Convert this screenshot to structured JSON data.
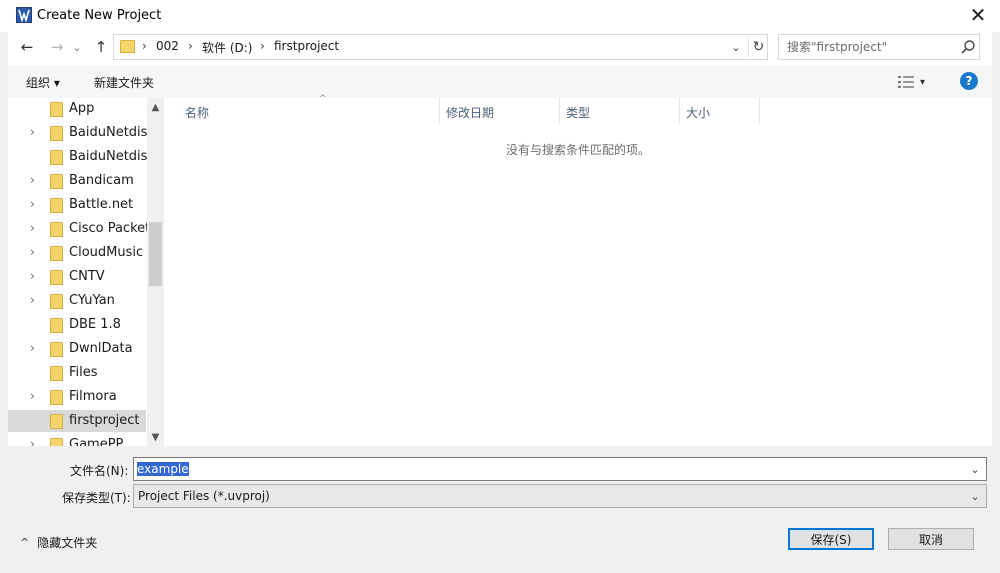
{
  "window": {
    "title": "Create New Project",
    "close_glyph": "✕"
  },
  "nav": {
    "back_glyph": "←",
    "forward_glyph": "→",
    "recent_glyph": "⌄",
    "up_glyph": "↑",
    "breadcrumb": [
      "002",
      "软件 (D:)",
      "firstproject"
    ],
    "separator": "›",
    "dropdown_glyph": "⌄",
    "refresh_glyph": "↻"
  },
  "search": {
    "placeholder": "搜索\"firstproject\""
  },
  "toolbar": {
    "organize_label": "组织 ▾",
    "new_folder_label": "新建文件夹",
    "view_arrow": "▾",
    "help_glyph": "?"
  },
  "tree": {
    "items": [
      {
        "label": "App",
        "expandable": false,
        "selected": false
      },
      {
        "label": "BaiduNetdisk",
        "expandable": true,
        "selected": false
      },
      {
        "label": "BaiduNetdisk",
        "expandable": false,
        "selected": false
      },
      {
        "label": "Bandicam",
        "expandable": true,
        "selected": false
      },
      {
        "label": "Battle.net",
        "expandable": true,
        "selected": false
      },
      {
        "label": "Cisco Packet",
        "expandable": true,
        "selected": false
      },
      {
        "label": "CloudMusic",
        "expandable": true,
        "selected": false
      },
      {
        "label": "CNTV",
        "expandable": true,
        "selected": false
      },
      {
        "label": "CYuYan",
        "expandable": true,
        "selected": false
      },
      {
        "label": "DBE 1.8",
        "expandable": false,
        "selected": false
      },
      {
        "label": "DwnlData",
        "expandable": true,
        "selected": false
      },
      {
        "label": "Files",
        "expandable": false,
        "selected": false
      },
      {
        "label": "Filmora",
        "expandable": true,
        "selected": false
      },
      {
        "label": "firstproject",
        "expandable": false,
        "selected": true
      },
      {
        "label": "GamePP",
        "expandable": true,
        "selected": false
      }
    ],
    "chevron_glyph": "›",
    "scroll_up": "▲",
    "scroll_down": "▼"
  },
  "columns": {
    "name": "名称",
    "modified": "修改日期",
    "type": "类型",
    "size": "大小",
    "sort_glyph": "^"
  },
  "empty_message": "没有与搜索条件匹配的项。",
  "form": {
    "filename_label": "文件名(N):",
    "filename_value": "example",
    "filetype_label": "保存类型(T):",
    "filetype_value": "Project Files (*.uvproj)",
    "dropdown_glyph": "⌄"
  },
  "footer": {
    "hide_folders_label": "隐藏文件夹",
    "hide_glyph": "^",
    "save_label": "保存(S)",
    "cancel_label": "取消"
  },
  "colors": {
    "accent": "#0078d7",
    "help": "#1979ca",
    "folder": "#f6d46b",
    "selection": "#d9d9d9"
  }
}
